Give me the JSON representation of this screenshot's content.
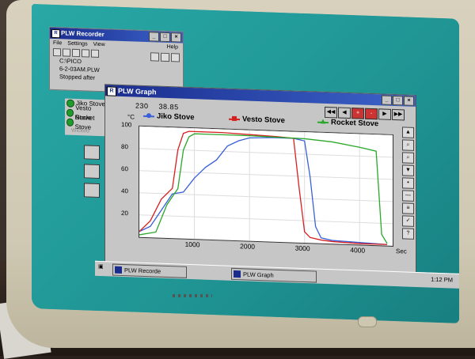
{
  "recorder": {
    "title": "PLW Recorder",
    "menu": [
      "File",
      "Settings",
      "View"
    ],
    "help": "Help",
    "line1": "C:\\PICO",
    "line2": "6-2-03AM.PLW",
    "line3": "Stopped after"
  },
  "stoves": [
    "Jiko Stove",
    "Vesto Stove",
    "Rocket Stove"
  ],
  "stove_sub": "Wicked",
  "graph": {
    "title": "PLW Graph",
    "readout_x": "230",
    "readout_y": "38.85",
    "unit_y": "°C",
    "unit_x": "Sec"
  },
  "taskbar": {
    "item1": "PLW Recorde",
    "item2": "PLW Graph",
    "clock": "1:12 PM"
  },
  "chart_data": {
    "type": "line",
    "title": "",
    "xlabel": "Sec",
    "ylabel": "°C",
    "xlim": [
      0,
      4600
    ],
    "ylim": [
      0,
      100
    ],
    "x_ticks": [
      1000,
      2000,
      3000,
      4000
    ],
    "y_ticks": [
      20,
      40,
      60,
      80,
      100
    ],
    "series": [
      {
        "name": "Jiko Stove",
        "color": "#3a5fd8",
        "x": [
          0,
          200,
          400,
          600,
          800,
          1000,
          1200,
          1400,
          1600,
          1800,
          2000,
          2400,
          2800,
          3000,
          3100,
          3200,
          3300,
          3500,
          4000,
          4500
        ],
        "y": [
          5,
          10,
          25,
          40,
          42,
          55,
          65,
          72,
          85,
          90,
          93,
          94,
          94,
          92,
          60,
          15,
          5,
          3,
          2,
          1
        ]
      },
      {
        "name": "Vesto Stove",
        "color": "#d62020",
        "x": [
          0,
          200,
          400,
          600,
          700,
          800,
          900,
          1000,
          1500,
          2000,
          2500,
          2800,
          2900,
          3000,
          3100,
          3300,
          3500,
          4000,
          4500
        ],
        "y": [
          5,
          15,
          35,
          45,
          80,
          95,
          97,
          97,
          97,
          96,
          95,
          94,
          50,
          10,
          5,
          3,
          2,
          1,
          1
        ]
      },
      {
        "name": "Rocket Stove",
        "color": "#2aa82a",
        "x": [
          0,
          300,
          500,
          700,
          800,
          900,
          1000,
          1500,
          2000,
          3000,
          3500,
          4000,
          4300,
          4400,
          4500
        ],
        "y": [
          2,
          5,
          30,
          45,
          80,
          92,
          95,
          95,
          95,
          94,
          92,
          88,
          85,
          10,
          2
        ]
      }
    ]
  }
}
